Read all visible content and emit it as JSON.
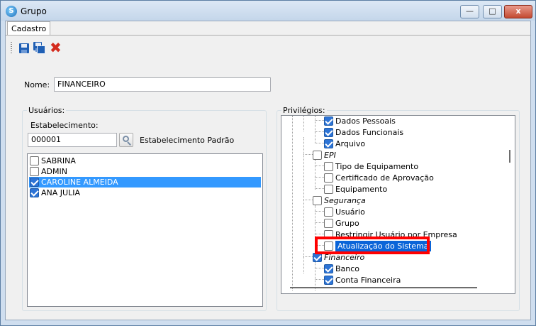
{
  "window": {
    "title": "Grupo",
    "app_icon_glyph": "S"
  },
  "titlebar_buttons": {
    "minimize": "—",
    "maximize": "□",
    "close": "x"
  },
  "tabs": [
    {
      "label": "Cadastro"
    }
  ],
  "toolbar": {
    "icons": [
      "save-icon",
      "save-copy-icon",
      "delete-icon"
    ],
    "delete_glyph": "✖"
  },
  "form": {
    "nome_label": "Nome:",
    "nome_value": "FINANCEIRO"
  },
  "usuarios": {
    "group_title": "Usuários:",
    "estabelecimento_label": "Estabelecimento:",
    "estabelecimento_value": "000001",
    "estabelecimento_padrao_label": "Estabelecimento Padrão",
    "users": [
      {
        "name": "SABRINA",
        "checked": false,
        "selected": false
      },
      {
        "name": "ADMIN",
        "checked": false,
        "selected": false
      },
      {
        "name": "CAROLINE ALMEIDA",
        "checked": true,
        "selected": true
      },
      {
        "name": "ANA JULIA",
        "checked": true,
        "selected": false
      }
    ]
  },
  "privilegios": {
    "group_title": "Privilégios:",
    "nodes": [
      {
        "label": "Dados Pessoais",
        "checked": true
      },
      {
        "label": "Dados Funcionais",
        "checked": true
      },
      {
        "label": "Arquivo",
        "checked": true
      },
      {
        "label": "EPI",
        "checked": false
      },
      {
        "label": "Tipo de Equipamento",
        "checked": false
      },
      {
        "label": "Certificado de Aprovação",
        "checked": false
      },
      {
        "label": "Equipamento",
        "checked": false
      },
      {
        "label": "Segurança",
        "checked": false
      },
      {
        "label": "Usuário",
        "checked": false
      },
      {
        "label": "Grupo",
        "checked": false
      },
      {
        "label": "Restringir Usuário por Empresa",
        "checked": false
      },
      {
        "label": "Atualização do Sistema",
        "checked": false,
        "selected": true
      },
      {
        "label": "Financeiro",
        "checked": true
      },
      {
        "label": "Banco",
        "checked": true
      },
      {
        "label": "Conta Financeira",
        "checked": true
      }
    ]
  },
  "colors": {
    "highlight_annotation": "#ff0000",
    "selection": "#3399ff",
    "check": "#2d74d6"
  }
}
